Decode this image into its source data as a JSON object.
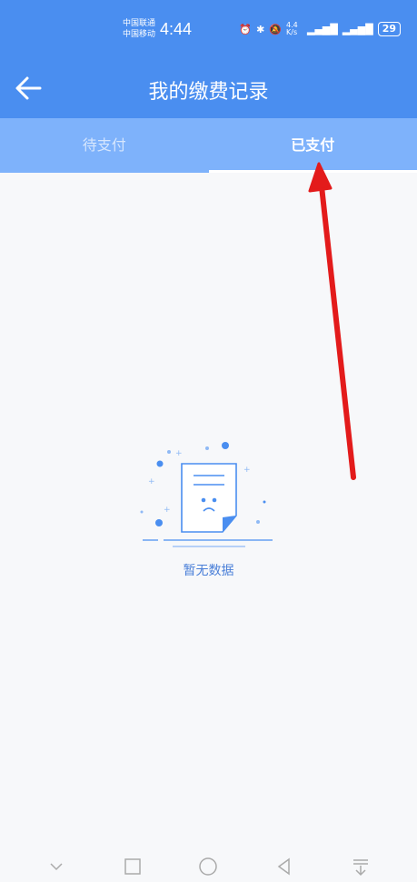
{
  "status_bar": {
    "carrier_1": "中国联通",
    "carrier_2": "中国移动",
    "time": "4:44",
    "network_speed": "4.4 K/s",
    "battery": "29"
  },
  "header": {
    "title": "我的缴费记录"
  },
  "tabs": [
    {
      "label": "待支付",
      "active": false
    },
    {
      "label": "已支付",
      "active": true
    }
  ],
  "empty_state": {
    "text": "暂无数据"
  },
  "colors": {
    "primary": "#4a8ef0",
    "tab_bar": "#7eb2fb",
    "annotation_arrow": "#e31b1b"
  }
}
